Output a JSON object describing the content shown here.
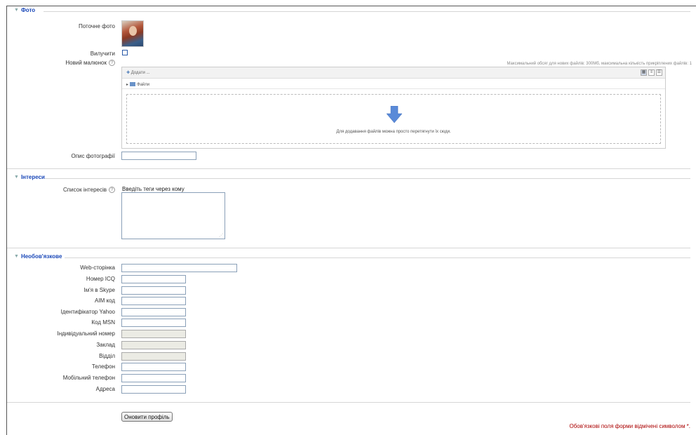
{
  "sections": {
    "photo": "Фото",
    "interests": "Інтереси",
    "optional": "Необов'язкове"
  },
  "photo": {
    "current_label": "Поточне фото",
    "delete_label": "Вилучити",
    "new_picture_label": "Новий малюнок",
    "max_info": "Максимальний обсяг для нових файлів: 300Мб, максимальна кількість прикріплених файлів: 1",
    "add_label": "Додати ...",
    "files_label": "Файли",
    "drop_text": "Для додавання файлів можна просто перетягнути їх сюди.",
    "description_label": "Опис фотографії",
    "description_value": ""
  },
  "interests": {
    "list_label": "Список інтересів",
    "placeholder": "Введіть теги через кому",
    "value": ""
  },
  "optional": {
    "fields": [
      {
        "label": "Web-сторінка",
        "value": ""
      },
      {
        "label": "Номер ICQ",
        "value": ""
      },
      {
        "label": "Ім'я в Skype",
        "value": ""
      },
      {
        "label": "AIM код",
        "value": ""
      },
      {
        "label": "Ідентифікатор Yahoo",
        "value": ""
      },
      {
        "label": "Код MSN",
        "value": ""
      },
      {
        "label": "Індивідуальний номер",
        "value": ""
      },
      {
        "label": "Заклад",
        "value": ""
      },
      {
        "label": "Відділ",
        "value": ""
      },
      {
        "label": "Телефон",
        "value": ""
      },
      {
        "label": "Мобільний телефон",
        "value": ""
      },
      {
        "label": "Адреса",
        "value": ""
      }
    ]
  },
  "submit_label": "Оновити профіль",
  "required_note": "Обов'язкові поля форми відмічені символом *."
}
